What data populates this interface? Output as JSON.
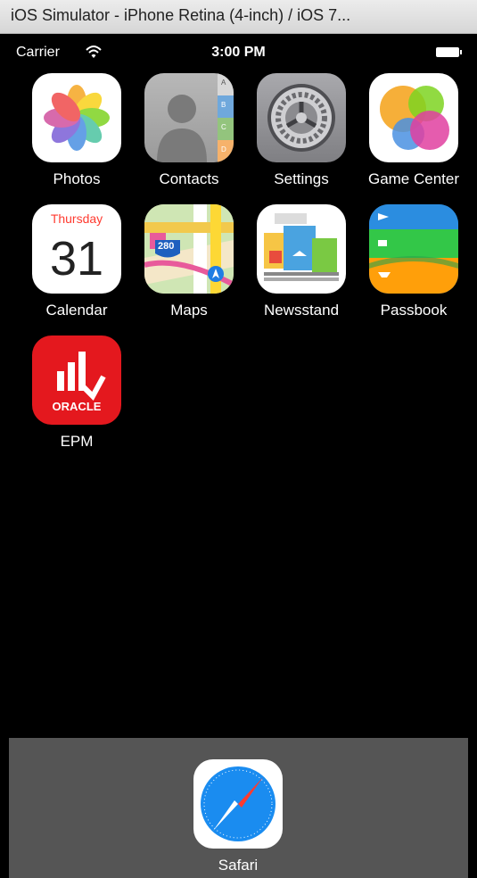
{
  "window": {
    "title": "iOS Simulator - iPhone Retina (4-inch) / iOS 7..."
  },
  "status_bar": {
    "carrier": "Carrier",
    "time": "3:00 PM",
    "wifi_icon": "wifi-icon",
    "battery_icon": "battery-icon"
  },
  "apps": {
    "photos": {
      "label": "Photos",
      "icon": "photos-icon"
    },
    "contacts": {
      "label": "Contacts",
      "icon": "contacts-icon",
      "tabs": [
        "A",
        "B",
        "C",
        "D"
      ]
    },
    "settings": {
      "label": "Settings",
      "icon": "settings-gear-icon"
    },
    "game_center": {
      "label": "Game Center",
      "icon": "game-center-bubbles-icon"
    },
    "calendar": {
      "label": "Calendar",
      "icon": "calendar-icon",
      "weekday": "Thursday",
      "day": "31"
    },
    "maps": {
      "label": "Maps",
      "icon": "maps-icon",
      "route": "280"
    },
    "newsstand": {
      "label": "Newsstand",
      "icon": "newsstand-icon"
    },
    "passbook": {
      "label": "Passbook",
      "icon": "passbook-icon"
    },
    "epm": {
      "label": "EPM",
      "icon": "oracle-epm-icon",
      "brand": "ORACLE"
    }
  },
  "dock": {
    "safari": {
      "label": "Safari",
      "icon": "safari-compass-icon"
    }
  },
  "colors": {
    "titlebar": "#dcdcdc",
    "homescreen": "#000000",
    "dock": "#555555",
    "oracle_red": "#e4181e",
    "calendar_red": "#ff3b30"
  }
}
